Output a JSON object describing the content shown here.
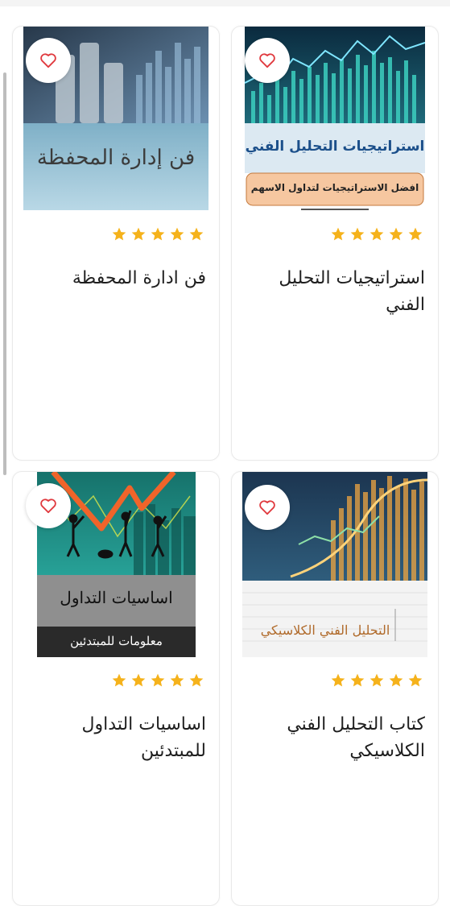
{
  "colors": {
    "star": "#f5b21b",
    "heart": "#e0393e",
    "title": "#1f1f1f",
    "card_border": "#e9e9e9"
  },
  "products": [
    {
      "title": "استراتيجيات التحليل الفني",
      "rating": 5,
      "cover_title": "استراتيجيات التحليل الفني",
      "cover_subtitle": "افضل الاستراتيجيات لتداول الاسهم"
    },
    {
      "title": "فن ادارة المحفظة",
      "rating": 5,
      "cover_title": "فن إدارة المحفظة"
    },
    {
      "title": "كتاب التحليل الفني الكلاسيكي",
      "rating": 5,
      "cover_title": "التحليل الفني الكلاسيكي"
    },
    {
      "title": "اساسيات التداول للمبتدئين",
      "rating": 5,
      "cover_title": "اساسيات التداول",
      "cover_subtitle": "معلومات للمبتدئين"
    }
  ]
}
